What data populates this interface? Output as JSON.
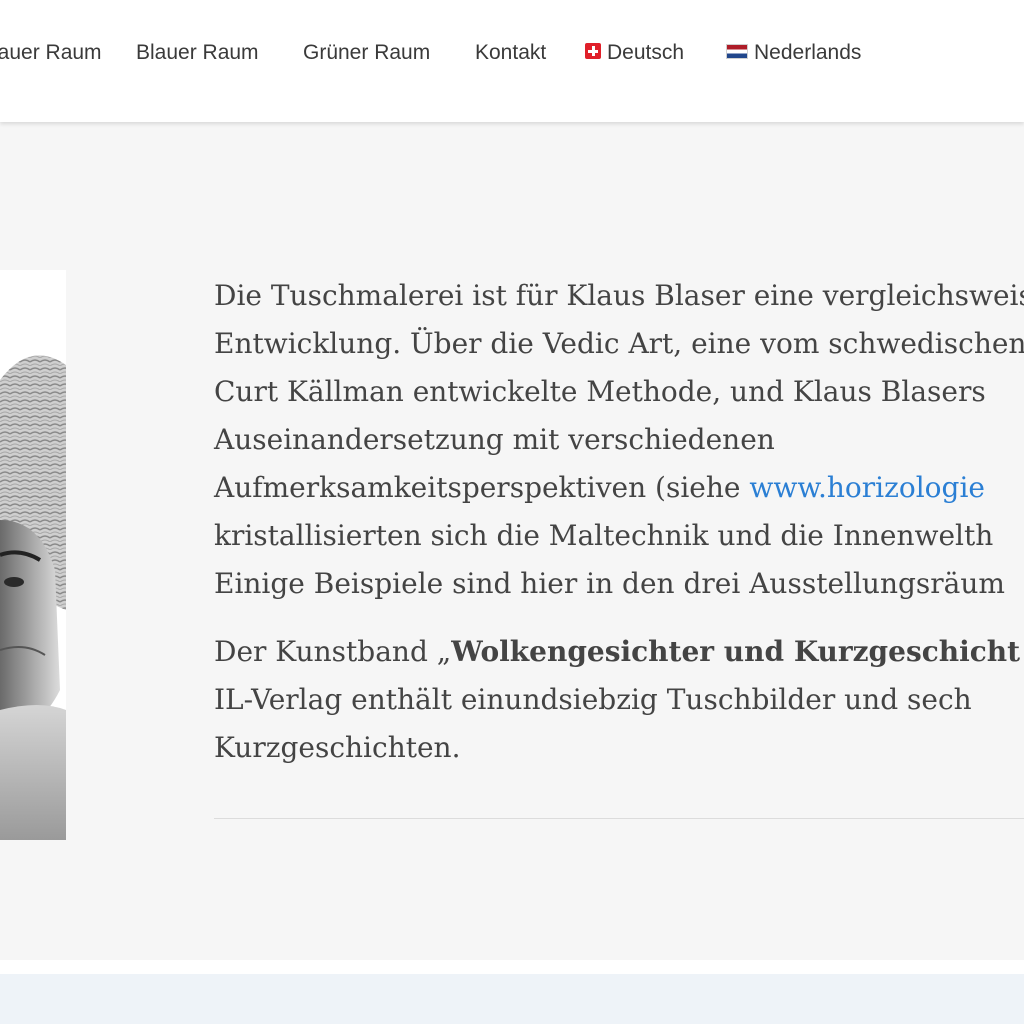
{
  "nav": {
    "items": [
      {
        "label": "lauer Raum"
      },
      {
        "label": "Blauer Raum"
      },
      {
        "label": "Grüner Raum"
      },
      {
        "label": "Kontakt"
      },
      {
        "label": "Deutsch",
        "flag": "swiss-flag-icon"
      },
      {
        "label": "Nederlands",
        "flag": "netherlands-flag-icon"
      }
    ]
  },
  "content": {
    "p1": {
      "l1": "Die Tuschmalerei ist für Klaus Blaser eine vergleichsweise",
      "l2": "Entwicklung. Über die Vedic Art, eine vom schwedischen",
      "l3": "Curt Källman entwickelte Methode, und Klaus Blasers",
      "l4": "Auseinandersetzung mit verschiedenen",
      "l5_pre": "Aufmerksamkeitsperspektiven (siehe ",
      "l5_link": "www.horizologie",
      "l6": "kristallisierten sich die Maltechnik und die Innenwelth",
      "l7": "Einige Beispiele sind hier in den drei Ausstellungsräum"
    },
    "p2": {
      "l1_pre": "Der Kunstband „",
      "l1_bold": "Wolkengesichter und Kurzgeschicht",
      "l2": "IL-Verlag enthält einundsiebzig Tuschbilder und sech",
      "l3": "Kurzgeschichten."
    }
  },
  "colors": {
    "link": "#2b7fd4",
    "text": "#444444",
    "nav_text": "#3a3a3a",
    "background": "#f6f6f6"
  }
}
